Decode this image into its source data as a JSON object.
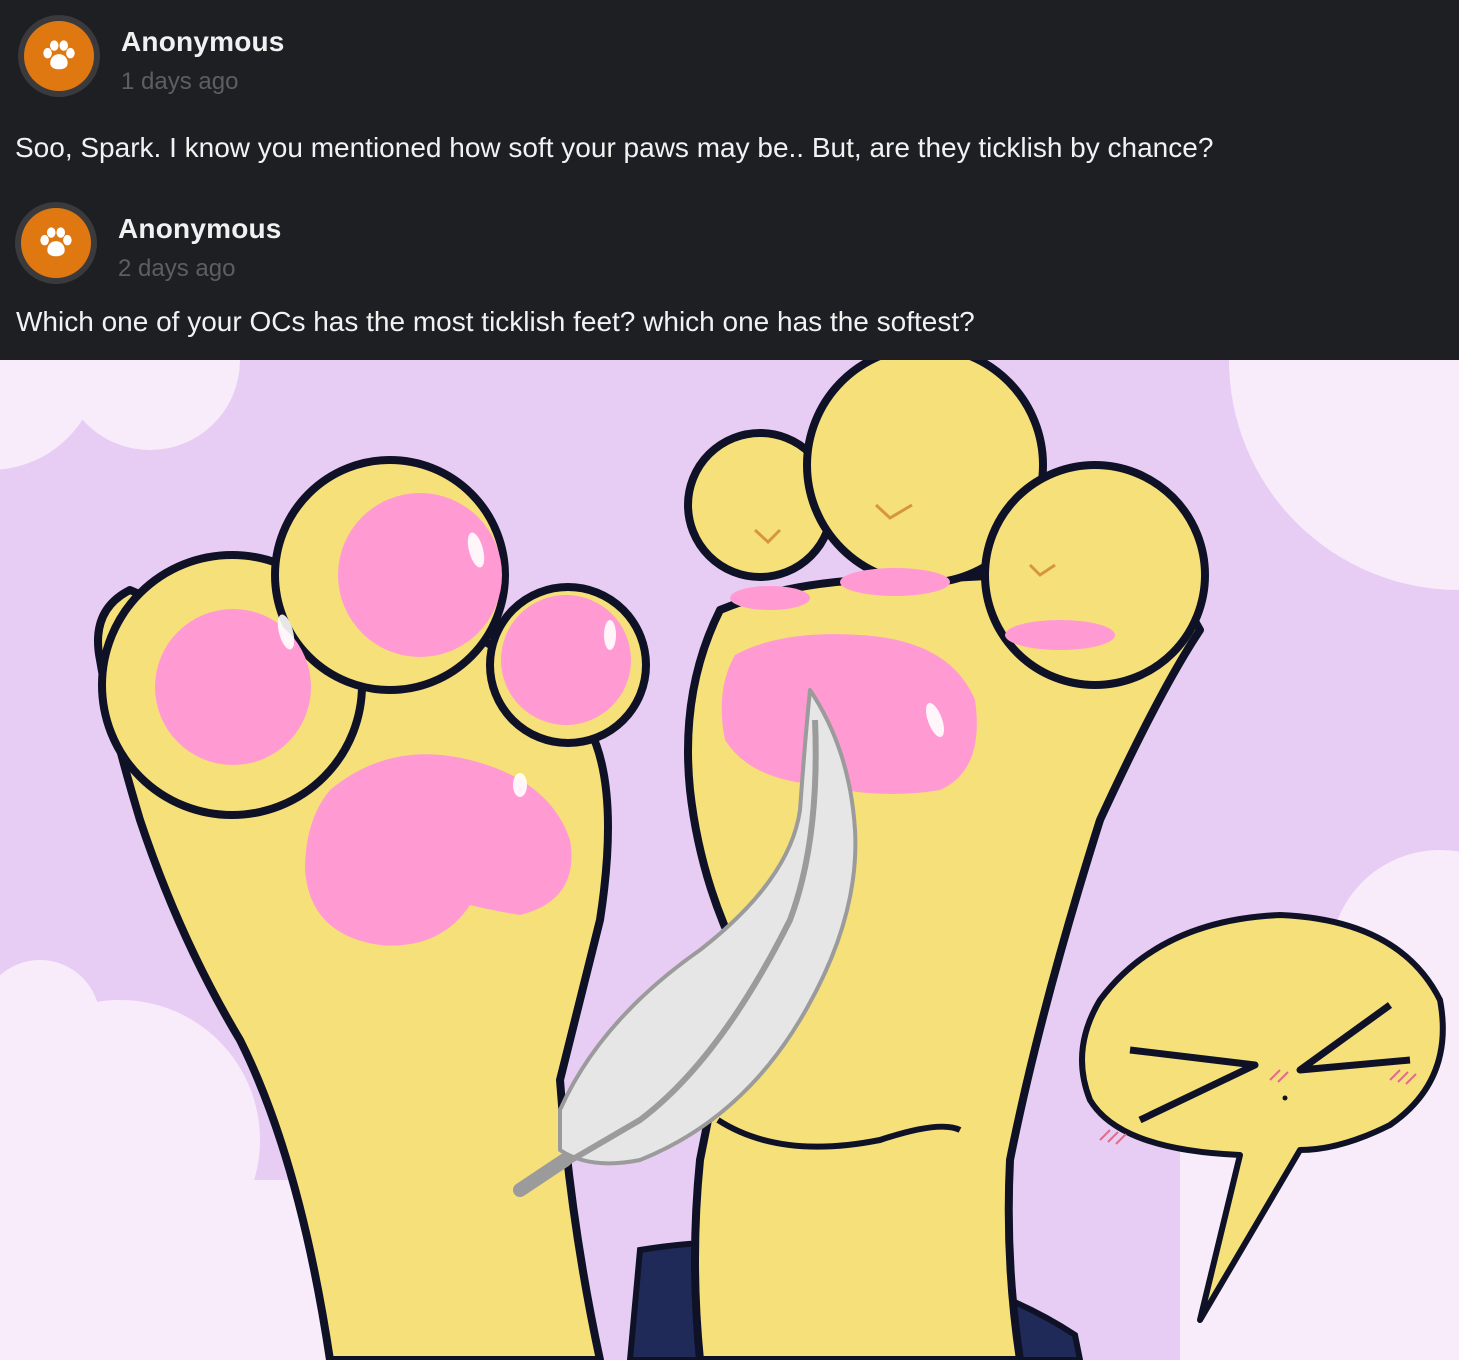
{
  "comments": [
    {
      "author": "Anonymous",
      "timestamp": "1 days ago",
      "avatar_icon": "paw-icon",
      "text": "Soo, Spark. I know you mentioned how soft your paws may be.. But, are they ticklish by chance?"
    },
    {
      "author": "Anonymous",
      "timestamp": "2 days ago",
      "avatar_icon": "paw-icon",
      "text": "Which one of your OCs has the most ticklish feet? which one has the softest?"
    }
  ],
  "colors": {
    "background": "#1e1f23",
    "avatar_accent": "#e07812",
    "timestamp": "#5d5e63",
    "art_background": "#e7cdf4",
    "paw_yellow": "#f6e07a",
    "pad_pink": "#ff9ad2",
    "sock_navy": "#1f2a58"
  },
  "illustration": {
    "subject": "two yellow paws being tickled with a feather, with a squinting emote speech bubble"
  }
}
